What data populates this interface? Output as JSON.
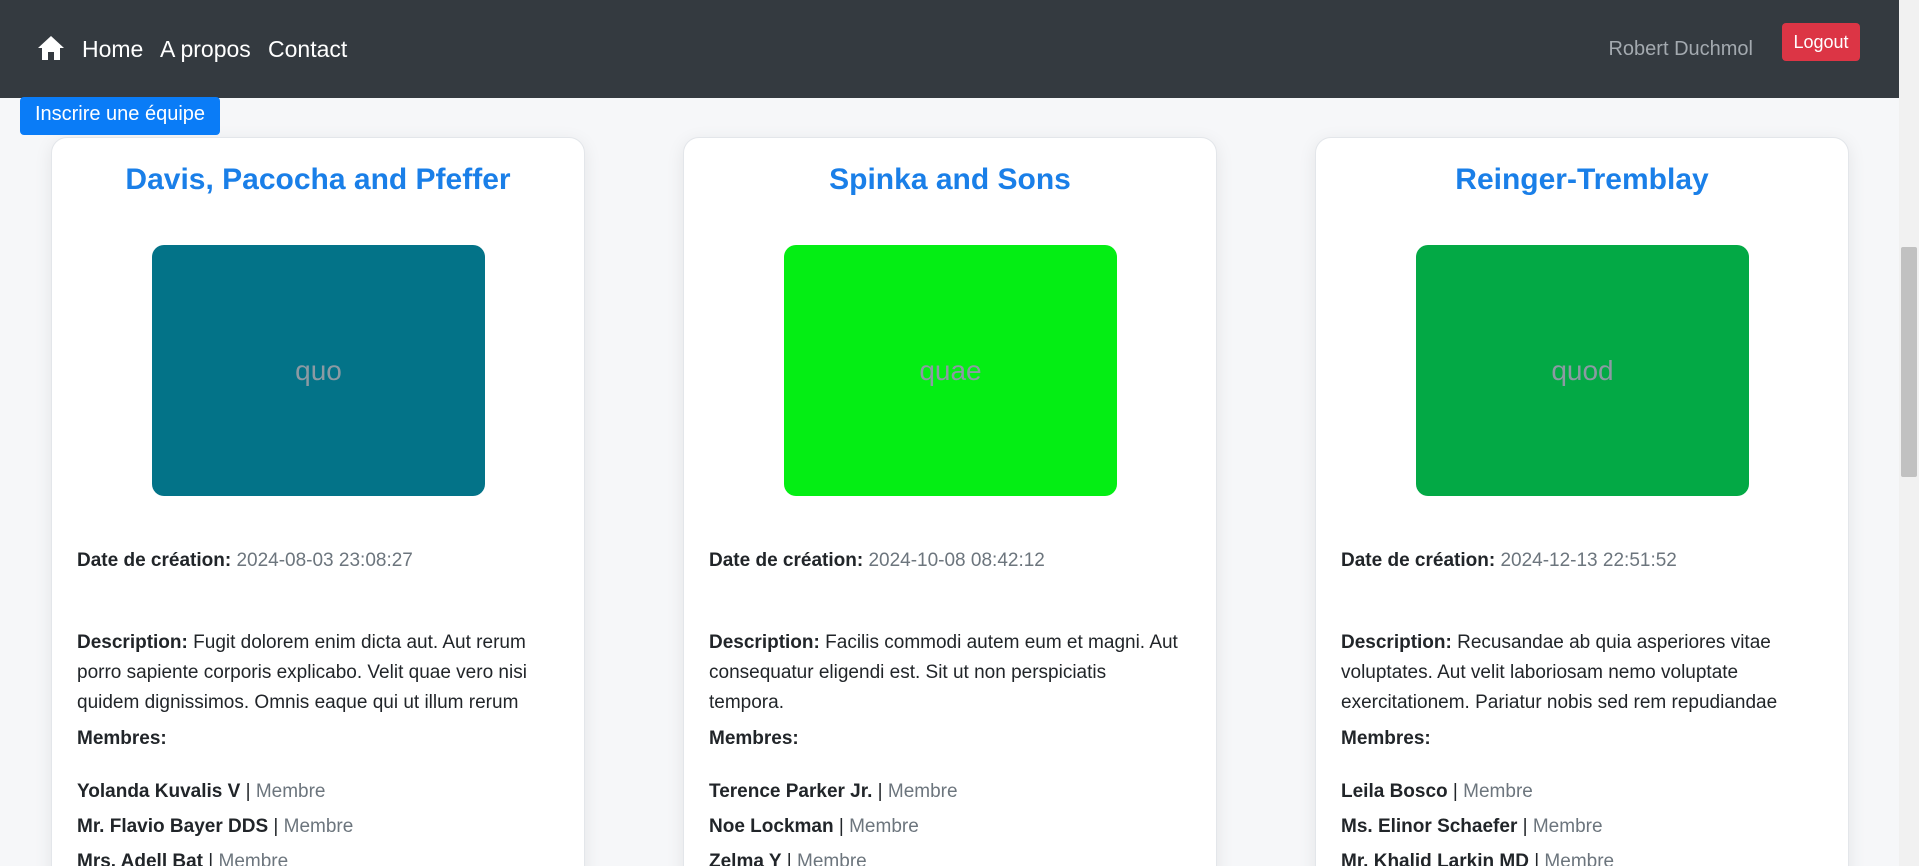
{
  "nav": {
    "home": "Home",
    "about": "A propos",
    "contact": "Contact",
    "user": "Robert Duchmol",
    "logout": "Logout"
  },
  "register_button": "Inscrire une équipe",
  "labels": {
    "date": "Date de création:",
    "description": "Description:",
    "members": "Membres:"
  },
  "cards": [
    {
      "title": "Davis, Pacocha and Pfeffer",
      "image_text": "quo",
      "image_color": "#037388",
      "date": "2024-08-03 23:08:27",
      "description": "Fugit dolorem enim dicta aut. Aut rerum porro sapiente corporis explicabo. Velit quae vero nisi quidem dignissimos. Omnis eaque qui ut illum rerum",
      "members": [
        {
          "name": "Yolanda Kuvalis V",
          "role": "Membre"
        },
        {
          "name": "Mr. Flavio Bayer DDS",
          "role": "Membre"
        },
        {
          "name": "Mrs. Adell Bat",
          "role": "Membre"
        }
      ]
    },
    {
      "title": "Spinka and Sons",
      "image_text": "quae",
      "image_color": "#04ee14",
      "date": "2024-10-08 08:42:12",
      "description": "Facilis commodi autem eum et magni. Aut consequatur eligendi est. Sit ut non perspiciatis tempora.",
      "members": [
        {
          "name": "Terence Parker Jr.",
          "role": "Membre"
        },
        {
          "name": "Noe Lockman",
          "role": "Membre"
        },
        {
          "name": "Zelma Y",
          "role": "Membre"
        }
      ]
    },
    {
      "title": "Reinger-Tremblay",
      "image_text": "quod",
      "image_color": "#03a945",
      "date": "2024-12-13 22:51:52",
      "description": "Recusandae ab quia asperiores vitae voluptates. Aut velit laboriosam nemo voluptate exercitationem. Pariatur nobis sed rem repudiandae",
      "members": [
        {
          "name": "Leila Bosco",
          "role": "Membre"
        },
        {
          "name": "Ms. Elinor Schaefer",
          "role": "Membre"
        },
        {
          "name": "Mr. Khalid Larkin MD",
          "role": "Membre"
        }
      ]
    }
  ]
}
